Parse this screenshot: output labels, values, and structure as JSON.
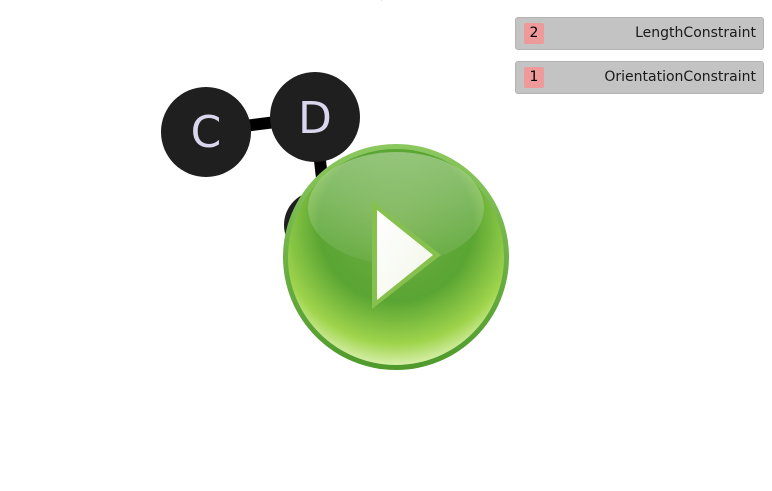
{
  "graph": {
    "nodes": [
      {
        "label": "C"
      },
      {
        "label": "D"
      }
    ],
    "node_fill": "#1f1f1f",
    "node_label_color": "#d9d6ee",
    "edge_color": "#000000"
  },
  "play_button": {
    "icon": "play-icon",
    "color": "#6bb33a"
  },
  "constraints": [
    {
      "priority": "2",
      "name": "LengthConstraint"
    },
    {
      "priority": "1",
      "name": "OrientationConstraint"
    }
  ]
}
